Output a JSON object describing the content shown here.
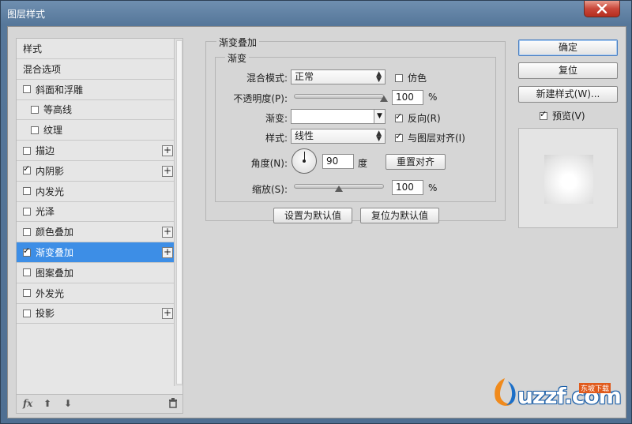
{
  "window": {
    "title": "图层样式"
  },
  "style_list": {
    "items": [
      {
        "label": "样式",
        "checkbox": false,
        "checked": false,
        "indent": false,
        "plus": false,
        "selected": false
      },
      {
        "label": "混合选项",
        "checkbox": false,
        "checked": false,
        "indent": false,
        "plus": false,
        "selected": false
      },
      {
        "label": "斜面和浮雕",
        "checkbox": true,
        "checked": false,
        "indent": false,
        "plus": false,
        "selected": false
      },
      {
        "label": "等高线",
        "checkbox": true,
        "checked": false,
        "indent": true,
        "plus": false,
        "selected": false
      },
      {
        "label": "纹理",
        "checkbox": true,
        "checked": false,
        "indent": true,
        "plus": false,
        "selected": false
      },
      {
        "label": "描边",
        "checkbox": true,
        "checked": false,
        "indent": false,
        "plus": true,
        "selected": false
      },
      {
        "label": "内阴影",
        "checkbox": true,
        "checked": true,
        "indent": false,
        "plus": true,
        "selected": false
      },
      {
        "label": "内发光",
        "checkbox": true,
        "checked": false,
        "indent": false,
        "plus": false,
        "selected": false
      },
      {
        "label": "光泽",
        "checkbox": true,
        "checked": false,
        "indent": false,
        "plus": false,
        "selected": false
      },
      {
        "label": "颜色叠加",
        "checkbox": true,
        "checked": false,
        "indent": false,
        "plus": true,
        "selected": false
      },
      {
        "label": "渐变叠加",
        "checkbox": true,
        "checked": true,
        "indent": false,
        "plus": true,
        "selected": true
      },
      {
        "label": "图案叠加",
        "checkbox": true,
        "checked": false,
        "indent": false,
        "plus": false,
        "selected": false
      },
      {
        "label": "外发光",
        "checkbox": true,
        "checked": false,
        "indent": false,
        "plus": false,
        "selected": false
      },
      {
        "label": "投影",
        "checkbox": true,
        "checked": false,
        "indent": false,
        "plus": true,
        "selected": false
      }
    ],
    "footer": {
      "fx_label": "fx"
    }
  },
  "panel": {
    "group_title": "渐变叠加",
    "subgroup_title": "渐变",
    "blend_mode": {
      "label": "混合模式:",
      "value": "正常"
    },
    "dither": {
      "label": "仿色",
      "checked": false
    },
    "opacity": {
      "label": "不透明度(P):",
      "value": "100",
      "unit": "%",
      "level": 1.0
    },
    "gradient": {
      "label": "渐变:"
    },
    "reverse": {
      "label": "反向(R)",
      "checked": true
    },
    "style": {
      "label": "样式:",
      "value": "线性"
    },
    "align": {
      "label": "与图层对齐(I)",
      "checked": true
    },
    "angle": {
      "label": "角度(N):",
      "value": "90",
      "unit": "度",
      "degrees": 90
    },
    "reset_align": {
      "label": "重置对齐"
    },
    "scale": {
      "label": "缩放(S):",
      "value": "100",
      "unit": "%",
      "level": 0.5
    },
    "set_default": {
      "label": "设置为默认值"
    },
    "reset_default": {
      "label": "复位为默认值"
    }
  },
  "right": {
    "ok": "确定",
    "reset": "复位",
    "new_style": "新建样式(W)...",
    "preview": {
      "label": "预览(V)",
      "checked": true
    }
  },
  "watermark": {
    "text": "uzzf.com",
    "tag": "东坡下载"
  },
  "colors": {
    "selection": "#3d8ee6",
    "dialog_bg": "#d6d6d6",
    "close": "#c9473a"
  }
}
